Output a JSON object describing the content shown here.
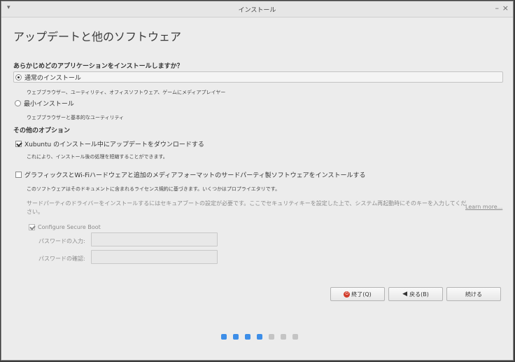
{
  "window": {
    "title": "インストール",
    "menu_icon": "▾",
    "minimize_icon": "–",
    "close_icon": "×"
  },
  "page_title": "アップデートと他のソフトウェア",
  "question": "あらかじめどのアプリケーションをインストールしますか？",
  "install_options": [
    {
      "label": "通常のインストール",
      "desc": "ウェブブラウザー、ユーティリティ、オフィスソフトウェア、ゲームにメディアプレイヤー",
      "selected": true
    },
    {
      "label": "最小インストール",
      "desc": "ウェブブラウザーと基本的なユーティリティ",
      "selected": false
    }
  ],
  "other_options_heading": "その他のオプション",
  "checks": [
    {
      "label": "Xubuntu のインストール中にアップデートをダウンロードする",
      "desc": "これにより、インストール後の処理を短縮することができます。",
      "checked": true
    },
    {
      "label": "グラフィックスとWi-Fiハードウェアと追加のメディアフォーマットのサードパーティ製ソフトウェアをインストールする",
      "desc": "このソフトウェアはそのドキュメントに含まれるライセンス規約に基づきます。いくつかはプロプライエタリです。",
      "checked": false
    }
  ],
  "secure_boot": {
    "text": "サードパーティのドライバーをインストールするにはセキュアブートの設定が必要です。ここでセキュリティキーを設定した上で、システム再起動時にそのキーを入力してください。",
    "learn_more": "Learn more...",
    "configure_label": "Configure Secure Boot",
    "configure_checked": true,
    "password_label": "パスワードの入力:",
    "confirm_label": "パスワードの確認:"
  },
  "buttons": {
    "quit": "終了(Q)",
    "back": "戻る(B)",
    "continue": "続ける"
  },
  "progress": {
    "total_steps": 7,
    "current_step": 4
  },
  "colors": {
    "accent": "#3d8ee8",
    "quit_icon": "#d23c2a"
  }
}
